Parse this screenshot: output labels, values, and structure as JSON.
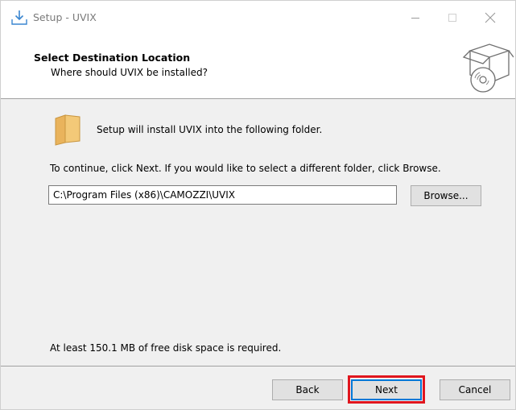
{
  "window": {
    "title": "Setup - UVIX",
    "controls": {
      "minimize_icon": "minimize-icon",
      "maximize_icon": "maximize-icon",
      "close_icon": "close-icon"
    }
  },
  "header": {
    "title": "Select Destination Location",
    "subtitle": "Where should UVIX be installed?"
  },
  "body": {
    "intro": "Setup will install UVIX into the following folder.",
    "instruction": "To continue, click Next. If you would like to select a different folder, click Browse.",
    "path_value": "C:\\Program Files (x86)\\CAMOZZI\\UVIX",
    "browse_label": "Browse...",
    "disk_space": "At least 150.1 MB of free disk space is required."
  },
  "footer": {
    "back_label": "Back",
    "next_label": "Next",
    "cancel_label": "Cancel"
  },
  "colors": {
    "highlight": "#e0161e",
    "focus": "#0078d7",
    "folder": "#f3c978"
  }
}
